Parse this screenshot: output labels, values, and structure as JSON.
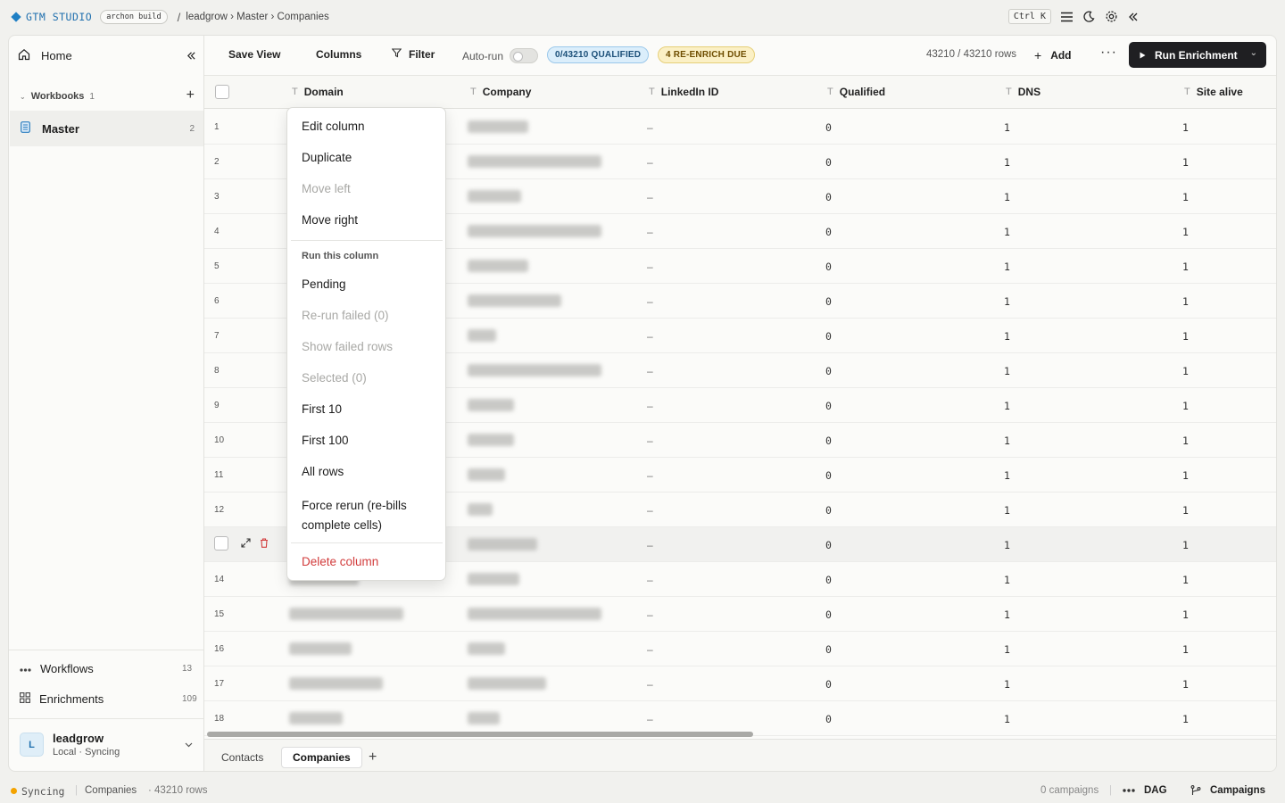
{
  "topbar": {
    "brand": "GTM STUDIO",
    "build_tag": "archon build",
    "breadcrumb_sep": "/",
    "breadcrumb": "leadgrow › Master › Companies",
    "shortcut": "Ctrl K"
  },
  "sidebar": {
    "home": "Home",
    "workbooks_label": "Workbooks",
    "workbooks_count": "1",
    "master_label": "Master",
    "master_count": "2",
    "workflows_label": "Workflows",
    "workflows_count": "13",
    "enrichments_label": "Enrichments",
    "enrichments_count": "109",
    "user_initial": "L",
    "user_name": "leadgrow",
    "user_status": "Local · Syncing"
  },
  "toolbar": {
    "save_view": "Save View",
    "columns": "Columns",
    "filter": "Filter",
    "autorun": "Auto-run",
    "badge_qualified": "0/43210 QUALIFIED",
    "badge_reenrich": "4 RE-ENRICH DUE",
    "rows_count": "43210 / 43210 rows",
    "add": "Add",
    "more": "···",
    "run_enrichment": "Run Enrichment"
  },
  "columns": [
    "Domain",
    "Company",
    "LinkedIn ID",
    "Qualified",
    "DNS",
    "Site alive"
  ],
  "rows": [
    {
      "idx": "1",
      "linkedin": "–",
      "qualified": "0",
      "dns": "1",
      "alive": "1"
    },
    {
      "idx": "2",
      "linkedin": "–",
      "qualified": "0",
      "dns": "1",
      "alive": "1"
    },
    {
      "idx": "3",
      "linkedin": "–",
      "qualified": "0",
      "dns": "1",
      "alive": "1"
    },
    {
      "idx": "4",
      "linkedin": "–",
      "qualified": "0",
      "dns": "1",
      "alive": "1"
    },
    {
      "idx": "5",
      "linkedin": "–",
      "qualified": "0",
      "dns": "1",
      "alive": "1"
    },
    {
      "idx": "6",
      "linkedin": "–",
      "qualified": "0",
      "dns": "1",
      "alive": "1"
    },
    {
      "idx": "7",
      "linkedin": "–",
      "qualified": "0",
      "dns": "1",
      "alive": "1"
    },
    {
      "idx": "8",
      "linkedin": "–",
      "qualified": "0",
      "dns": "1",
      "alive": "1"
    },
    {
      "idx": "9",
      "linkedin": "–",
      "qualified": "0",
      "dns": "1",
      "alive": "1"
    },
    {
      "idx": "10",
      "linkedin": "–",
      "qualified": "0",
      "dns": "1",
      "alive": "1"
    },
    {
      "idx": "11",
      "linkedin": "–",
      "qualified": "0",
      "dns": "1",
      "alive": "1"
    },
    {
      "idx": "12",
      "linkedin": "–",
      "qualified": "0",
      "dns": "1",
      "alive": "1"
    },
    {
      "idx": "",
      "linkedin": "–",
      "qualified": "0",
      "dns": "1",
      "alive": "1"
    },
    {
      "idx": "14",
      "linkedin": "–",
      "qualified": "0",
      "dns": "1",
      "alive": "1"
    },
    {
      "idx": "15",
      "linkedin": "–",
      "qualified": "0",
      "dns": "1",
      "alive": "1"
    },
    {
      "idx": "16",
      "linkedin": "–",
      "qualified": "0",
      "dns": "1",
      "alive": "1"
    },
    {
      "idx": "17",
      "linkedin": "–",
      "qualified": "0",
      "dns": "1",
      "alive": "1"
    },
    {
      "idx": "18",
      "linkedin": "–",
      "qualified": "0",
      "dns": "1",
      "alive": "1"
    }
  ],
  "context_menu": {
    "edit_column": "Edit column",
    "duplicate": "Duplicate",
    "move_left": "Move left",
    "move_right": "Move right",
    "section_run": "Run this column",
    "pending": "Pending",
    "rerun_failed": "Re-run failed (0)",
    "show_failed": "Show failed rows",
    "selected": "Selected (0)",
    "first_10": "First 10",
    "first_100": "First 100",
    "all_rows": "All rows",
    "force_rerun_1": "Force rerun (re-bills",
    "force_rerun_2": "complete cells)",
    "delete_column": "Delete column"
  },
  "tabs": {
    "contacts": "Contacts",
    "companies": "Companies",
    "add": "+"
  },
  "statusbar": {
    "syncing": "Syncing",
    "table": "Companies",
    "rows": "· 43210 rows",
    "campaigns_count": "0 campaigns",
    "dag": "DAG",
    "campaigns": "Campaigns"
  },
  "colors": {
    "accent_blue": "#1f6fae",
    "run_button": "#1f1f22",
    "delete_red": "#d23c3c",
    "sync_dot": "#f4a300"
  }
}
